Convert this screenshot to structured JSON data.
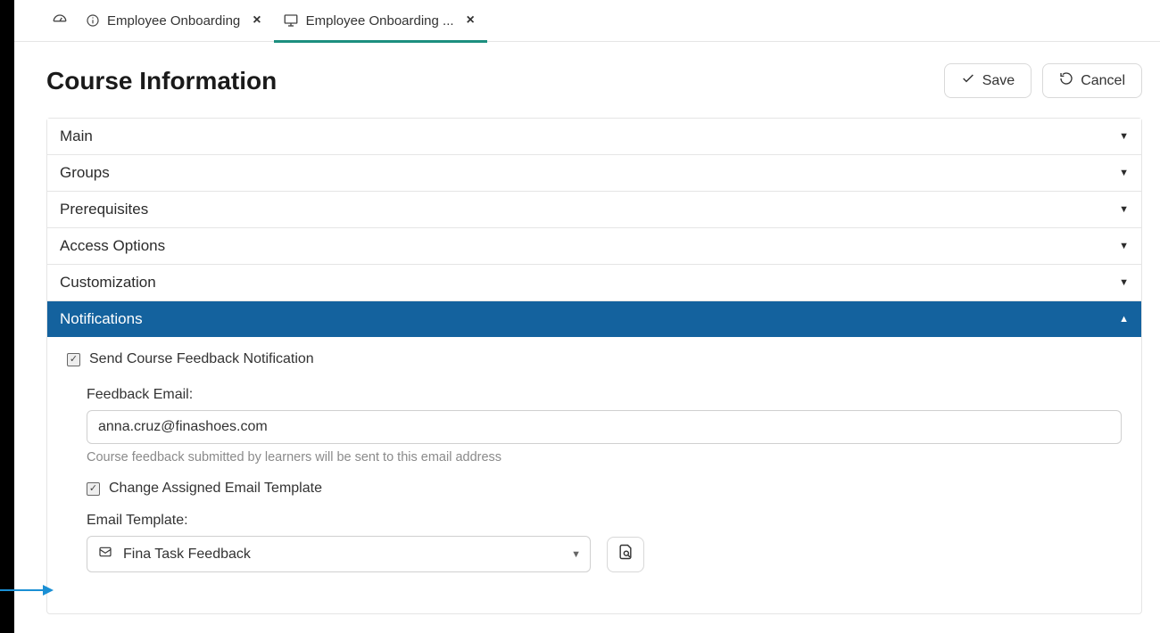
{
  "tabs": [
    {
      "label": "Employee Onboarding"
    },
    {
      "label": "Employee Onboarding ..."
    }
  ],
  "header": {
    "title": "Course Information",
    "save_label": "Save",
    "cancel_label": "Cancel"
  },
  "sections": {
    "main": "Main",
    "groups": "Groups",
    "prerequisites": "Prerequisites",
    "access_options": "Access Options",
    "customization": "Customization",
    "notifications": "Notifications"
  },
  "notifications": {
    "send_feedback_label": "Send Course Feedback Notification",
    "feedback_email_label": "Feedback Email:",
    "feedback_email_value": "anna.cruz@finashoes.com",
    "feedback_email_hint": "Course feedback submitted by learners will be sent to this email address",
    "change_template_label": "Change Assigned Email Template",
    "email_template_label": "Email Template:",
    "email_template_value": "Fina Task Feedback"
  }
}
